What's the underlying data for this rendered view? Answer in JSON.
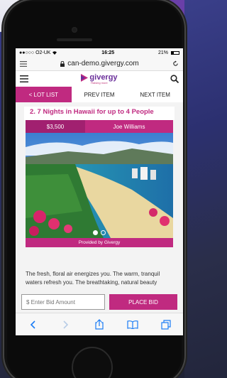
{
  "status": {
    "carrier": "●●○○○ O2-UK",
    "wifi_icon": "wifi-icon",
    "time": "16:25",
    "battery": "21%"
  },
  "browser": {
    "url": "can-demo.givergy.com",
    "lock_icon": "lock-icon",
    "reload_icon": "reload-icon"
  },
  "header": {
    "logo_text": "givergy",
    "logo_tagline": "Raising more"
  },
  "lot_nav": {
    "lot_list": "< LOT LIST",
    "prev": "PREV ITEM",
    "next": "NEXT ITEM"
  },
  "lot": {
    "title": "2. 7 Nights in Hawaii for up to 4 People",
    "price": "$3,500",
    "donor": "Joe Williams",
    "provided_by": "Provided by Givergy",
    "description": "The fresh, floral air energizes you. The warm, tranquil waters refresh you. The breathtaking, natural beauty",
    "carousel": {
      "slides": 2,
      "active": 1
    }
  },
  "bid": {
    "placeholder": "$ Enter Bid Amount",
    "button": "PLACE BID"
  },
  "colors": {
    "brand_pink": "#c02a80",
    "brand_purple": "#6a2e9a",
    "safari_blue": "#1a7cf5"
  }
}
